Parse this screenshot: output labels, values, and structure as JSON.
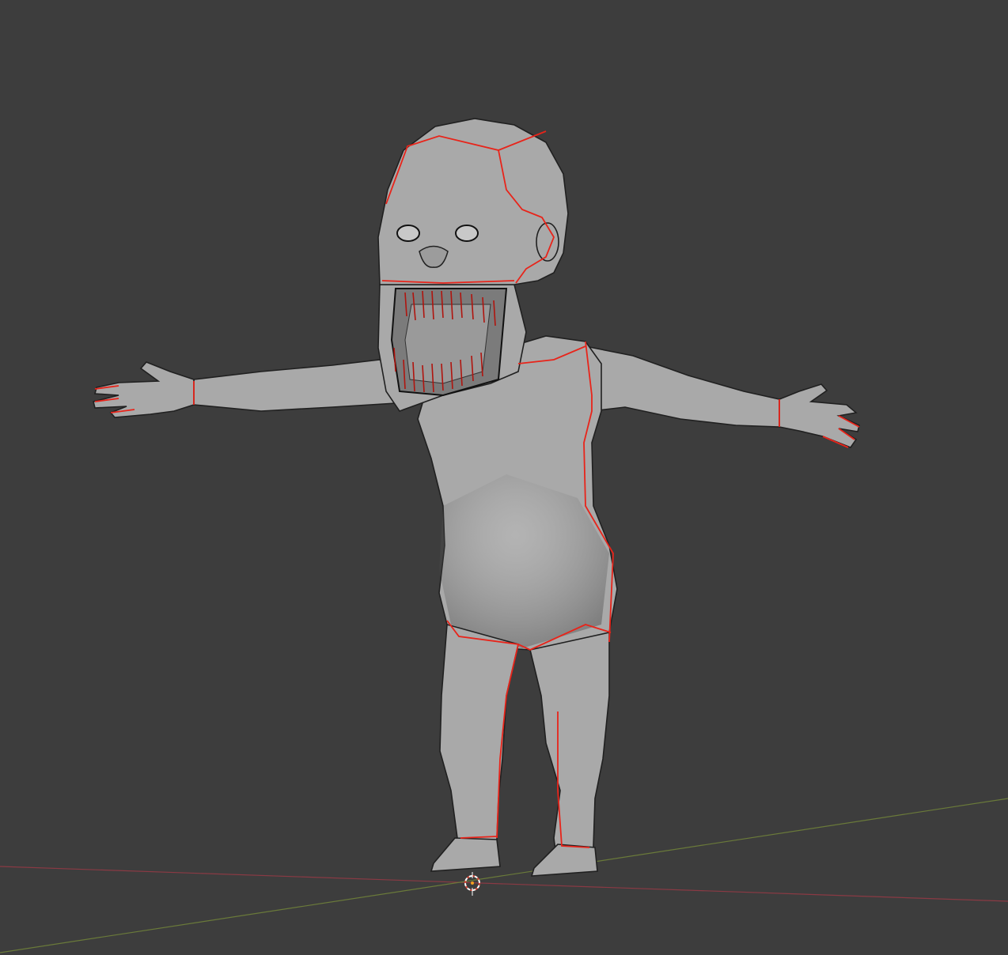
{
  "viewport": {
    "background": "#3d3d3d",
    "mesh_color": "#a9a9a9",
    "wire_color": "#202020",
    "seam_color": "#e8241a",
    "axis_x_color": "#8a3a44",
    "axis_y_color": "#6a7a3a",
    "cursor_icon": "3d-cursor-icon",
    "object": "creature-mesh",
    "pose": "T-pose",
    "shading": "solid-wireframe-overlay"
  }
}
